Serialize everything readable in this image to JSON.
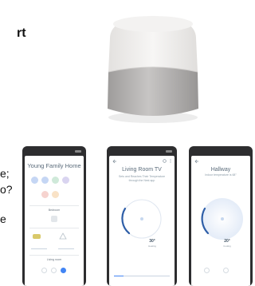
{
  "left_text": {
    "heading": "rt",
    "line1": "e;",
    "line2": "o?",
    "line3": "e"
  },
  "product": {
    "speaker_icon": "smart-speaker-image"
  },
  "phones": [
    {
      "title": "Young Family Home",
      "favorites_label": "Bedroom",
      "section_2_label": "Living room"
    },
    {
      "title": "Living Room TV",
      "subtitle": "Sets and Reaches Their Temperature through the Nest app",
      "temperature": "30°",
      "temperature_sub": "Heating"
    },
    {
      "title": "Hallway",
      "subtitle": "Indoor temperature is 68°",
      "temperature": "20°",
      "temperature_sub": "Cooling"
    }
  ],
  "colors": {
    "phone_body": "#2d2d2f",
    "ring_blue": "#2f5fa8",
    "ring_light": "#c6d7ef",
    "dot_blue": "#c5d6f4",
    "dot_green": "#cfe9d9",
    "dot_purple": "#d9d4f0",
    "dot_red": "#f6d3cf",
    "dot_orange": "#f9e2c6"
  }
}
